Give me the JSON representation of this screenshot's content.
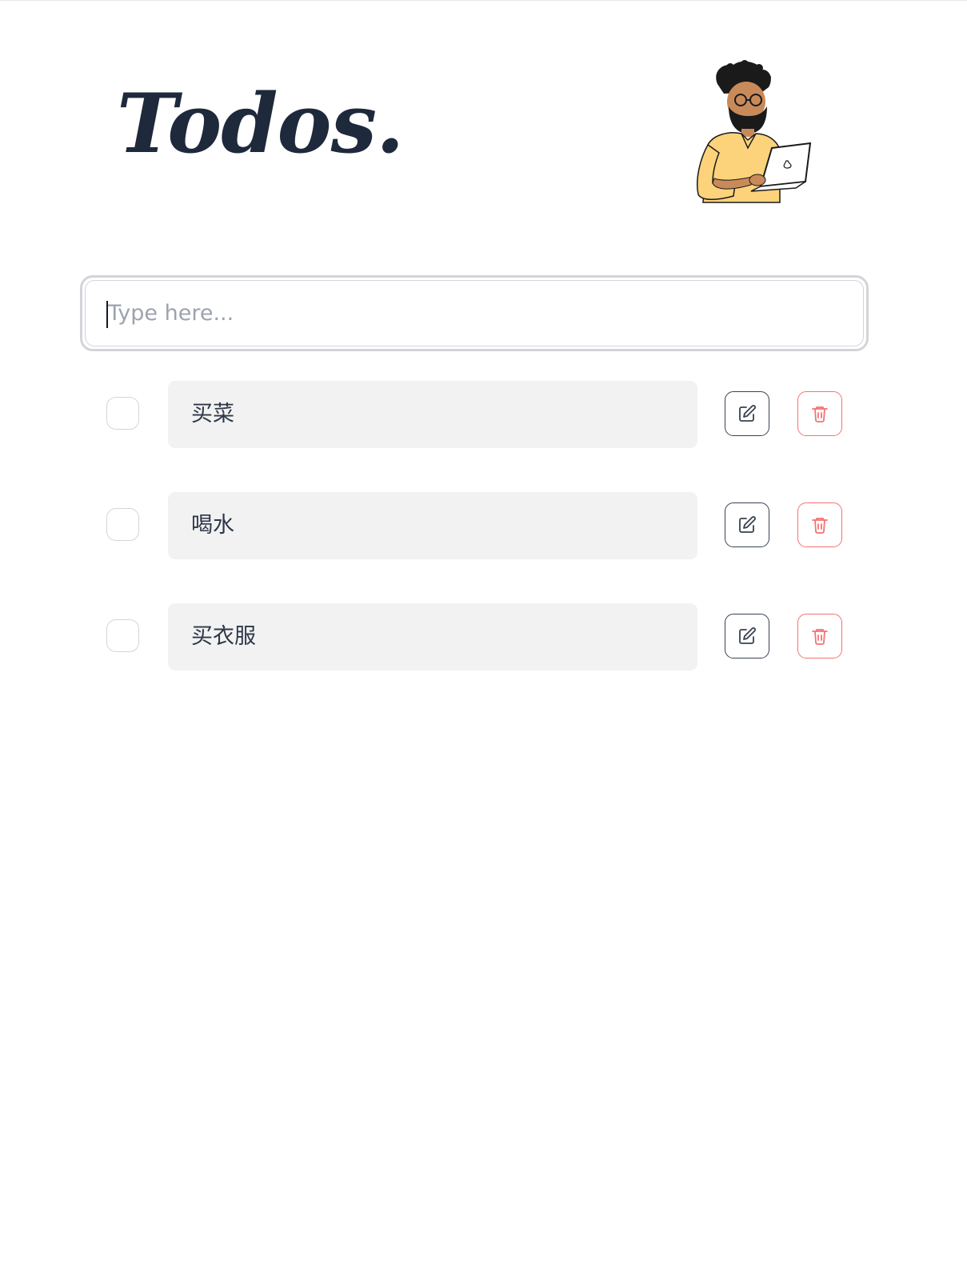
{
  "header": {
    "title": "Todos."
  },
  "illustration": {
    "icon": "person-with-laptop-illustration"
  },
  "input": {
    "placeholder": "Type here...",
    "value": ""
  },
  "todos": [
    {
      "text": "买菜",
      "done": false
    },
    {
      "text": "喝水",
      "done": false
    },
    {
      "text": "买衣服",
      "done": false
    }
  ],
  "icons": {
    "edit": "pencil-square-icon",
    "delete": "trash-icon"
  },
  "colors": {
    "title": "#1e293b",
    "item_background": "#f2f2f2",
    "edit_border": "#374151",
    "delete_accent": "#f87171",
    "shirt": "#fcd27b"
  }
}
